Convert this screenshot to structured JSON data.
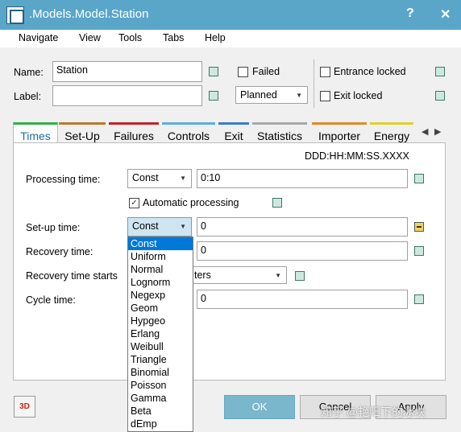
{
  "window": {
    "title": ".Models.Model.Station",
    "help": "?",
    "close": "✕"
  },
  "menu": [
    "Navigate",
    "View",
    "Tools",
    "Tabs",
    "Help"
  ],
  "header": {
    "name_label": "Name:",
    "name_value": "Station",
    "label_label": "Label:",
    "label_value": "",
    "failed": "Failed",
    "planned": "Planned",
    "entrance_locked": "Entrance locked",
    "exit_locked": "Exit locked"
  },
  "tabs": [
    {
      "label": "Times",
      "color": "#2db24a"
    },
    {
      "label": "Set-Up",
      "color": "#c0782a"
    },
    {
      "label": "Failures",
      "color": "#c8202a"
    },
    {
      "label": "Controls",
      "color": "#5aaee0"
    },
    {
      "label": "Exit",
      "color": "#3a7ad0"
    },
    {
      "label": "Statistics",
      "color": "#a8a8a8"
    },
    {
      "label": "Importer",
      "color": "#e08a2a"
    },
    {
      "label": "Energy",
      "color": "#e0d030"
    }
  ],
  "times": {
    "format": "DDD:HH:MM:SS.XXXX",
    "processing_label": "Processing time:",
    "processing_dist": "Const",
    "processing_value": "0:10",
    "auto_processing": "Automatic processing",
    "setup_label": "Set-up time:",
    "setup_dist": "Const",
    "setup_value": "0",
    "recovery_label": "Recovery time:",
    "recovery_value": "0",
    "recovery_starts_label": "Recovery time starts",
    "recovery_starts_value": "ters",
    "cycle_label": "Cycle time:",
    "cycle_value": "0"
  },
  "dropdown": [
    "Const",
    "Uniform",
    "Normal",
    "Lognorm",
    "Negexp",
    "Geom",
    "Hypgeo",
    "Erlang",
    "Weibull",
    "Triangle",
    "Binomial",
    "Poisson",
    "Gamma",
    "Beta",
    "dEmp"
  ],
  "buttons": {
    "three_d": "3D",
    "ok": "OK",
    "cancel": "Cancel",
    "apply": "Apply"
  },
  "watermark": "知乎 @艳阳下的冰块"
}
